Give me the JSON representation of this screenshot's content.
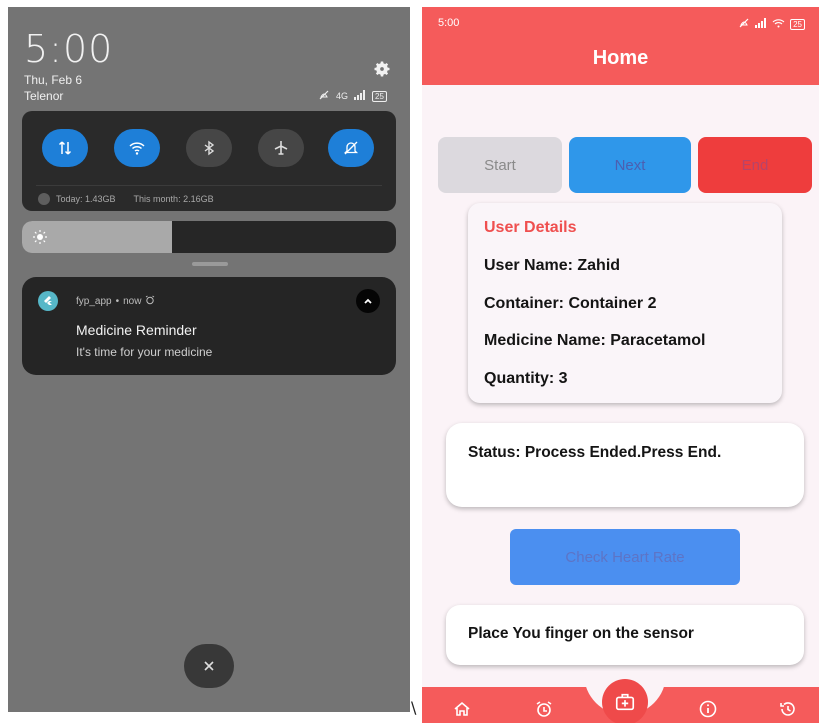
{
  "left_panel": {
    "time": "5:00",
    "date": "Thu, Feb 6",
    "carrier": "Telenor",
    "status_network": "4G",
    "battery": "25",
    "data_usage": {
      "today": "Today: 1.43GB",
      "month": "This month: 2.16GB"
    },
    "brightness_level": 0.4,
    "quick_settings": [
      {
        "icon": "data-transfer-icon",
        "on": true
      },
      {
        "icon": "wifi-icon",
        "on": true
      },
      {
        "icon": "bluetooth-icon",
        "on": false
      },
      {
        "icon": "airplane-icon",
        "on": false
      },
      {
        "icon": "silent-bell-icon",
        "on": true
      }
    ],
    "notification": {
      "app": "fyp_app",
      "time": "now",
      "title": "Medicine Reminder",
      "body": "It's time for your medicine"
    },
    "stray_char": "\\"
  },
  "right_panel": {
    "status_time": "5:00",
    "battery": "25",
    "title": "Home",
    "buttons": {
      "start": "Start",
      "next": "Next",
      "end": "End"
    },
    "user_details": {
      "heading": "User Details",
      "user_name": "User Name: Zahid",
      "container": "Container: Container 2",
      "medicine": "Medicine Name: Paracetamol",
      "quantity": "Quantity: 3"
    },
    "status": "Status: Process Ended.Press End.",
    "heart_rate_button": "Check Heart Rate",
    "sensor_message": "Place You finger on the sensor",
    "nav": [
      "home-icon",
      "alarm-icon",
      "medical-kit-icon",
      "info-icon",
      "history-icon"
    ],
    "accent_color": "#f55b5b"
  }
}
